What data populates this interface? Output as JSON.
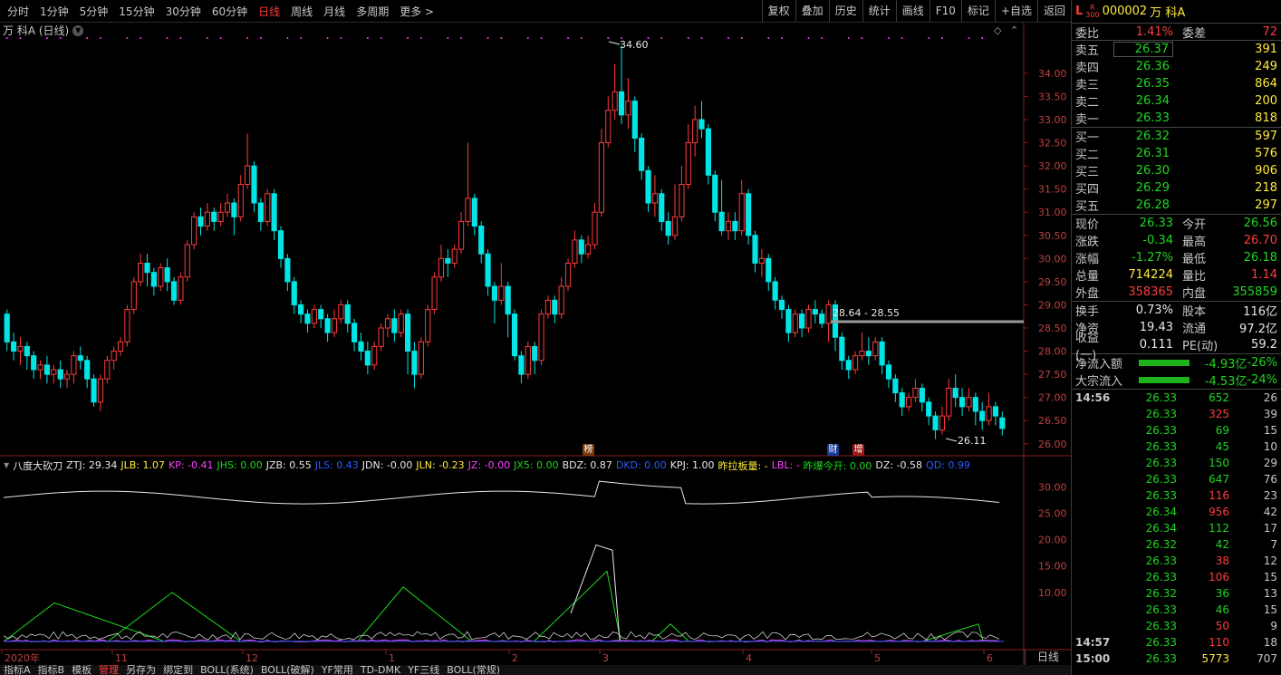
{
  "toolbar": {
    "periods": [
      "分时",
      "1分钟",
      "5分钟",
      "15分钟",
      "30分钟",
      "60分钟",
      "日线",
      "周线",
      "月线",
      "多周期",
      "更多 >"
    ],
    "active_period": "日线",
    "actions": [
      "复权",
      "叠加",
      "历史",
      "统计",
      "画线",
      "F10",
      "标记",
      "+自选",
      "返回"
    ]
  },
  "chart_title": "万 科A (日线)",
  "indicator": {
    "name": "八度大砍刀",
    "items": [
      {
        "k": "ZTJ",
        "v": "29.34",
        "c": "#e8e8e8"
      },
      {
        "k": "JLB",
        "v": "1.07",
        "c": "#ffeb3b"
      },
      {
        "k": "KP",
        "v": "-0.41",
        "c": "#ff40ff"
      },
      {
        "k": "JHS",
        "v": "0.00",
        "c": "#1ed81e"
      },
      {
        "k": "JZB",
        "v": "0.55",
        "c": "#e8e8e8"
      },
      {
        "k": "JLS",
        "v": "0.43",
        "c": "#2a5cff"
      },
      {
        "k": "JDN",
        "v": "-0.00",
        "c": "#e8e8e8"
      },
      {
        "k": "JLN",
        "v": "-0.23",
        "c": "#ffeb3b"
      },
      {
        "k": "JZ",
        "v": "-0.00",
        "c": "#ff40ff"
      },
      {
        "k": "JX5",
        "v": "0.00",
        "c": "#1ed81e"
      },
      {
        "k": "BDZ",
        "v": "0.87",
        "c": "#e8e8e8"
      },
      {
        "k": "DKD",
        "v": "0.00",
        "c": "#2a5cff"
      },
      {
        "k": "KPJ",
        "v": "1.00",
        "c": "#e8e8e8"
      },
      {
        "k": "昨拉板量",
        "v": "-",
        "c": "#ffeb3b"
      },
      {
        "k": "LBL",
        "v": "-",
        "c": "#ff40ff"
      },
      {
        "k": "昨爆今开",
        "v": "0.00",
        "c": "#1ed81e"
      },
      {
        "k": "DZ",
        "v": "-0.58",
        "c": "#e8e8e8"
      },
      {
        "k": "QD",
        "v": "0.99",
        "c": "#2a5cff"
      }
    ]
  },
  "price_axis": [
    "34.00",
    "33.50",
    "33.00",
    "32.50",
    "32.00",
    "31.50",
    "31.00",
    "30.50",
    "30.00",
    "29.50",
    "29.00",
    "28.50",
    "28.00",
    "27.50",
    "27.00",
    "26.50",
    "26.00"
  ],
  "ind_axis": [
    "30.00",
    "25.00",
    "20.00",
    "15.00",
    "10.00"
  ],
  "date_axis": [
    "2020年",
    "11",
    "12",
    "1",
    "2",
    "3",
    "4",
    "5",
    "6"
  ],
  "annotations": {
    "high": "34.60",
    "low": "26.11",
    "range_line": "28.64 - 28.55"
  },
  "markers": [
    {
      "t": "榜",
      "bg": "#7a3a10",
      "fg": "#ffffff"
    },
    {
      "t": "财",
      "bg": "#1a3a9a",
      "fg": "#ffffff"
    },
    {
      "t": "增",
      "bg": "#a01818",
      "fg": "#ffffff"
    }
  ],
  "period_label": "日线",
  "bottom_tabs": [
    "指标A",
    "指标B",
    "模板",
    "管理",
    "另存为",
    "绑定到",
    "BOLL(系统)",
    "BOLL(破解)",
    "YF常用",
    "TD-DMK",
    "YF三线",
    "BOLL(常规)"
  ],
  "bottom_active": "管理",
  "chart_data": {
    "type": "candlestick",
    "y_range": [
      25.8,
      34.8
    ],
    "candles": [
      [
        28.8,
        28.2,
        28.9,
        28.0
      ],
      [
        28.2,
        28.0,
        28.4,
        27.8
      ],
      [
        28.0,
        28.1,
        28.3,
        27.7
      ],
      [
        28.1,
        27.9,
        28.2,
        27.6
      ],
      [
        27.9,
        27.6,
        28.0,
        27.4
      ],
      [
        27.6,
        27.7,
        27.8,
        27.4
      ],
      [
        27.7,
        27.5,
        27.9,
        27.3
      ],
      [
        27.5,
        27.6,
        27.7,
        27.3
      ],
      [
        27.6,
        27.4,
        27.8,
        27.2
      ],
      [
        27.4,
        27.5,
        27.6,
        27.2
      ],
      [
        27.5,
        27.9,
        28.0,
        27.3
      ],
      [
        27.9,
        27.8,
        28.1,
        27.6
      ],
      [
        27.8,
        27.4,
        27.9,
        27.2
      ],
      [
        27.4,
        26.9,
        27.5,
        26.8
      ],
      [
        26.9,
        27.4,
        27.5,
        26.7
      ],
      [
        27.4,
        27.8,
        27.9,
        27.3
      ],
      [
        27.8,
        28.0,
        28.1,
        27.6
      ],
      [
        28.0,
        28.2,
        28.3,
        27.9
      ],
      [
        28.2,
        28.9,
        29.0,
        28.1
      ],
      [
        28.9,
        29.5,
        29.6,
        28.8
      ],
      [
        29.5,
        29.9,
        30.1,
        29.4
      ],
      [
        29.9,
        29.7,
        30.1,
        29.4
      ],
      [
        29.7,
        29.4,
        29.8,
        29.2
      ],
      [
        29.4,
        29.8,
        29.9,
        29.3
      ],
      [
        29.8,
        29.5,
        30.0,
        29.3
      ],
      [
        29.5,
        29.1,
        29.6,
        29.0
      ],
      [
        29.1,
        29.6,
        29.7,
        29.0
      ],
      [
        29.6,
        30.3,
        30.4,
        29.5
      ],
      [
        30.3,
        30.9,
        31.0,
        30.2
      ],
      [
        30.9,
        30.7,
        31.1,
        30.5
      ],
      [
        30.7,
        31.0,
        31.2,
        30.6
      ],
      [
        31.0,
        30.8,
        31.1,
        30.6
      ],
      [
        30.8,
        31.0,
        31.2,
        30.7
      ],
      [
        31.0,
        31.2,
        31.4,
        30.9
      ],
      [
        31.2,
        30.9,
        31.3,
        30.5
      ],
      [
        30.9,
        31.6,
        31.8,
        30.8
      ],
      [
        31.6,
        32.0,
        32.7,
        31.5
      ],
      [
        32.0,
        31.2,
        32.1,
        31.0
      ],
      [
        31.2,
        30.8,
        31.3,
        30.6
      ],
      [
        30.8,
        31.4,
        31.5,
        30.7
      ],
      [
        31.4,
        30.6,
        31.5,
        30.4
      ],
      [
        30.6,
        30.0,
        30.7,
        29.8
      ],
      [
        30.0,
        29.5,
        30.1,
        29.3
      ],
      [
        29.5,
        29.0,
        29.6,
        28.8
      ],
      [
        29.0,
        28.8,
        29.1,
        28.6
      ],
      [
        28.8,
        28.6,
        28.9,
        28.4
      ],
      [
        28.6,
        28.9,
        29.0,
        28.5
      ],
      [
        28.9,
        28.7,
        29.0,
        28.5
      ],
      [
        28.7,
        28.4,
        28.8,
        28.2
      ],
      [
        28.4,
        28.7,
        28.9,
        28.3
      ],
      [
        28.7,
        29.0,
        29.1,
        28.6
      ],
      [
        29.0,
        28.6,
        29.1,
        28.4
      ],
      [
        28.6,
        28.2,
        28.7,
        28.0
      ],
      [
        28.2,
        28.0,
        28.4,
        27.8
      ],
      [
        28.0,
        27.7,
        28.2,
        27.5
      ],
      [
        27.7,
        28.1,
        28.2,
        27.6
      ],
      [
        28.1,
        28.5,
        28.6,
        28.0
      ],
      [
        28.5,
        28.7,
        28.8,
        28.3
      ],
      [
        28.7,
        28.4,
        28.9,
        28.2
      ],
      [
        28.4,
        28.8,
        28.9,
        28.3
      ],
      [
        28.8,
        28.0,
        28.9,
        27.5
      ],
      [
        28.0,
        27.5,
        28.2,
        27.2
      ],
      [
        27.5,
        28.2,
        28.3,
        27.4
      ],
      [
        28.2,
        28.9,
        29.0,
        28.1
      ],
      [
        28.9,
        29.6,
        29.7,
        28.8
      ],
      [
        29.6,
        30.0,
        30.3,
        29.5
      ],
      [
        30.0,
        29.9,
        30.2,
        29.6
      ],
      [
        29.9,
        30.2,
        30.3,
        29.8
      ],
      [
        30.2,
        30.8,
        31.0,
        30.1
      ],
      [
        30.8,
        31.3,
        32.5,
        30.7
      ],
      [
        31.3,
        30.7,
        31.4,
        30.5
      ],
      [
        30.7,
        30.1,
        30.8,
        29.9
      ],
      [
        30.1,
        29.4,
        30.2,
        29.2
      ],
      [
        29.4,
        29.1,
        29.5,
        28.6
      ],
      [
        29.1,
        29.4,
        29.9,
        29.0
      ],
      [
        29.4,
        28.8,
        29.5,
        28.3
      ],
      [
        28.8,
        27.9,
        28.9,
        27.8
      ],
      [
        27.9,
        27.5,
        28.0,
        27.3
      ],
      [
        27.5,
        28.1,
        28.2,
        27.4
      ],
      [
        28.1,
        27.8,
        28.2,
        27.5
      ],
      [
        27.8,
        28.8,
        28.9,
        27.7
      ],
      [
        28.8,
        29.1,
        29.2,
        28.7
      ],
      [
        29.1,
        28.8,
        29.2,
        28.6
      ],
      [
        28.8,
        29.4,
        29.6,
        28.7
      ],
      [
        29.4,
        29.9,
        30.0,
        29.3
      ],
      [
        29.9,
        30.4,
        30.6,
        29.8
      ],
      [
        30.4,
        30.1,
        30.5,
        29.9
      ],
      [
        30.1,
        30.3,
        30.5,
        30.0
      ],
      [
        30.3,
        31.0,
        31.2,
        30.2
      ],
      [
        31.0,
        32.5,
        32.8,
        30.9
      ],
      [
        32.5,
        33.2,
        33.5,
        32.4
      ],
      [
        33.2,
        33.6,
        34.2,
        33.0
      ],
      [
        33.6,
        33.1,
        34.6,
        32.9
      ],
      [
        33.1,
        33.4,
        33.9,
        32.8
      ],
      [
        33.4,
        32.6,
        33.5,
        32.3
      ],
      [
        32.6,
        31.9,
        32.7,
        31.7
      ],
      [
        31.9,
        31.2,
        32.0,
        31.0
      ],
      [
        31.2,
        31.4,
        31.8,
        30.9
      ],
      [
        31.4,
        30.8,
        31.5,
        30.6
      ],
      [
        30.8,
        30.5,
        31.0,
        30.3
      ],
      [
        30.5,
        30.9,
        31.6,
        30.4
      ],
      [
        30.9,
        31.6,
        32.0,
        30.8
      ],
      [
        31.6,
        32.5,
        32.9,
        31.5
      ],
      [
        32.5,
        33.0,
        33.3,
        32.2
      ],
      [
        33.0,
        32.8,
        33.4,
        32.6
      ],
      [
        32.8,
        31.8,
        32.9,
        31.6
      ],
      [
        31.8,
        31.0,
        31.9,
        30.8
      ],
      [
        31.0,
        30.6,
        31.7,
        30.5
      ],
      [
        30.6,
        30.8,
        31.0,
        30.4
      ],
      [
        30.8,
        30.6,
        31.0,
        30.4
      ],
      [
        30.6,
        31.4,
        31.7,
        30.5
      ],
      [
        31.4,
        30.5,
        31.5,
        30.3
      ],
      [
        30.5,
        29.9,
        30.6,
        29.7
      ],
      [
        29.9,
        30.0,
        30.2,
        29.6
      ],
      [
        30.0,
        29.5,
        30.1,
        29.3
      ],
      [
        29.5,
        29.1,
        29.6,
        28.9
      ],
      [
        29.1,
        28.9,
        29.2,
        28.7
      ],
      [
        28.9,
        28.4,
        29.0,
        28.2
      ],
      [
        28.4,
        28.8,
        28.9,
        28.3
      ],
      [
        28.8,
        28.5,
        28.9,
        28.3
      ],
      [
        28.5,
        28.9,
        29.0,
        28.4
      ],
      [
        28.9,
        28.8,
        29.1,
        28.6
      ],
      [
        28.8,
        28.6,
        28.9,
        28.5
      ],
      [
        28.6,
        29.0,
        29.1,
        28.2
      ],
      [
        29.0,
        28.3,
        29.1,
        28.0
      ],
      [
        28.3,
        27.8,
        28.4,
        27.6
      ],
      [
        27.8,
        27.6,
        27.9,
        27.4
      ],
      [
        27.6,
        27.9,
        28.0,
        27.5
      ],
      [
        27.9,
        28.0,
        28.4,
        27.8
      ],
      [
        28.0,
        27.9,
        28.3,
        27.7
      ],
      [
        27.9,
        28.2,
        28.3,
        27.8
      ],
      [
        28.2,
        27.7,
        28.3,
        27.5
      ],
      [
        27.7,
        27.4,
        27.8,
        27.2
      ],
      [
        27.4,
        27.1,
        27.5,
        26.9
      ],
      [
        27.1,
        26.8,
        27.2,
        26.6
      ],
      [
        26.8,
        27.0,
        27.1,
        26.7
      ],
      [
        27.0,
        27.2,
        27.4,
        26.9
      ],
      [
        27.2,
        26.9,
        27.3,
        26.7
      ],
      [
        26.9,
        26.6,
        27.0,
        26.4
      ],
      [
        26.6,
        26.3,
        26.7,
        26.1
      ],
      [
        26.3,
        26.6,
        26.8,
        26.2
      ],
      [
        26.6,
        27.2,
        27.4,
        26.5
      ],
      [
        27.2,
        27.0,
        27.5,
        26.8
      ],
      [
        27.0,
        26.8,
        27.2,
        26.6
      ],
      [
        26.8,
        27.0,
        27.2,
        26.7
      ],
      [
        27.0,
        26.7,
        27.1,
        26.4
      ],
      [
        26.7,
        26.5,
        26.9,
        26.3
      ],
      [
        26.5,
        26.8,
        27.1,
        26.4
      ],
      [
        26.8,
        26.6,
        26.9,
        26.4
      ],
      [
        26.56,
        26.33,
        26.7,
        26.18
      ]
    ]
  },
  "panel": {
    "code": "000002",
    "name": "万 科A",
    "wb": {
      "label": "委比",
      "value": "1.41%",
      "label2": "委差",
      "value2": "72"
    },
    "sells": [
      {
        "label": "卖五",
        "price": "26.37",
        "qty": "391"
      },
      {
        "label": "卖四",
        "price": "26.36",
        "qty": "249"
      },
      {
        "label": "卖三",
        "price": "26.35",
        "qty": "864"
      },
      {
        "label": "卖二",
        "price": "26.34",
        "qty": "200"
      },
      {
        "label": "卖一",
        "price": "26.33",
        "qty": "818"
      }
    ],
    "buys": [
      {
        "label": "买一",
        "price": "26.32",
        "qty": "597"
      },
      {
        "label": "买二",
        "price": "26.31",
        "qty": "576"
      },
      {
        "label": "买三",
        "price": "26.30",
        "qty": "906"
      },
      {
        "label": "买四",
        "price": "26.29",
        "qty": "218"
      },
      {
        "label": "买五",
        "price": "26.28",
        "qty": "297"
      }
    ],
    "quote": [
      {
        "l": "现价",
        "v": "26.33",
        "vc": "green",
        "l2": "今开",
        "v2": "26.56",
        "v2c": "green"
      },
      {
        "l": "涨跌",
        "v": "-0.34",
        "vc": "green",
        "l2": "最高",
        "v2": "26.70",
        "v2c": "red"
      },
      {
        "l": "涨幅",
        "v": "-1.27%",
        "vc": "green",
        "l2": "最低",
        "v2": "26.18",
        "v2c": "green"
      },
      {
        "l": "总量",
        "v": "714224",
        "vc": "yellow",
        "l2": "量比",
        "v2": "1.14",
        "v2c": "red"
      },
      {
        "l": "外盘",
        "v": "358365",
        "vc": "red",
        "l2": "内盘",
        "v2": "355859",
        "v2c": "green"
      }
    ],
    "stats": [
      {
        "l": "换手",
        "v": "0.73%",
        "l2": "股本",
        "v2": "116亿"
      },
      {
        "l": "净资",
        "v": "19.43",
        "l2": "流通",
        "v2": "97.2亿"
      },
      {
        "l": "收益(一)",
        "v": "0.111",
        "l2": "PE(动)",
        "v2": "59.2"
      }
    ],
    "flows": [
      {
        "l": "净流入额",
        "v": "-4.93亿",
        "p": "-26%"
      },
      {
        "l": "大宗流入",
        "v": "-4.53亿",
        "p": "-24%"
      }
    ],
    "ticks": [
      {
        "t": "14:56",
        "p": "26.33",
        "v": "652",
        "vc": "green",
        "n": "26"
      },
      {
        "t": "",
        "p": "26.33",
        "v": "325",
        "vc": "red",
        "n": "39"
      },
      {
        "t": "",
        "p": "26.33",
        "v": "69",
        "vc": "green",
        "n": "15"
      },
      {
        "t": "",
        "p": "26.33",
        "v": "45",
        "vc": "green",
        "n": "10"
      },
      {
        "t": "",
        "p": "26.33",
        "v": "150",
        "vc": "green",
        "n": "29"
      },
      {
        "t": "",
        "p": "26.33",
        "v": "647",
        "vc": "green",
        "n": "76"
      },
      {
        "t": "",
        "p": "26.33",
        "v": "116",
        "vc": "red",
        "n": "23"
      },
      {
        "t": "",
        "p": "26.34",
        "v": "956",
        "vc": "red",
        "n": "42"
      },
      {
        "t": "",
        "p": "26.34",
        "v": "112",
        "vc": "green",
        "n": "17"
      },
      {
        "t": "",
        "p": "26.32",
        "v": "42",
        "vc": "green",
        "n": "7"
      },
      {
        "t": "",
        "p": "26.33",
        "v": "38",
        "vc": "red",
        "n": "12"
      },
      {
        "t": "",
        "p": "26.33",
        "v": "106",
        "vc": "red",
        "n": "15"
      },
      {
        "t": "",
        "p": "26.32",
        "v": "36",
        "vc": "green",
        "n": "13"
      },
      {
        "t": "",
        "p": "26.33",
        "v": "46",
        "vc": "green",
        "n": "15"
      },
      {
        "t": "",
        "p": "26.33",
        "v": "50",
        "vc": "red",
        "n": "9"
      },
      {
        "t": "14:57",
        "p": "26.33",
        "v": "110",
        "vc": "red",
        "n": "18"
      },
      {
        "t": "15:00",
        "p": "26.33",
        "v": "5773",
        "vc": "yellow",
        "n": "707"
      }
    ]
  }
}
